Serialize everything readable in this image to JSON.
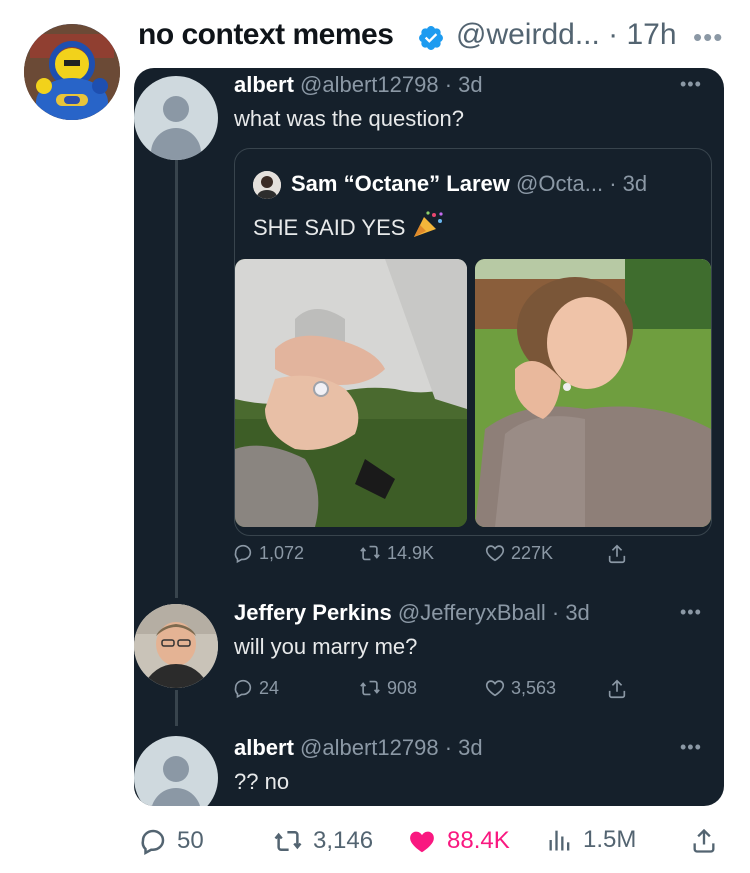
{
  "header": {
    "display_name": "no context memes",
    "handle_time": "@weirdd... · 17h",
    "more_icon": "more-horizontal-icon"
  },
  "embedded_thread": {
    "tweet1": {
      "name": "albert",
      "handle_time": "@albert12798 · 3d",
      "text": "what was the question?"
    },
    "quote": {
      "name": "Sam “Octane” Larew",
      "handle_time": "@Octa... · 3d",
      "text": "SHE SAID YES",
      "emoji_icon": "party-popper-icon",
      "stats": {
        "replies": "1,072",
        "retweets": "14.9K",
        "likes": "227K"
      }
    },
    "tweet2": {
      "name": "Jeffery Perkins",
      "handle_time": "@JefferyxBball · 3d",
      "text": "will you marry me?",
      "stats": {
        "replies": "24",
        "retweets": "908",
        "likes": "3,563"
      }
    },
    "tweet3": {
      "name": "albert",
      "handle_time": "@albert12798 · 3d",
      "text": "?? no"
    }
  },
  "actions": {
    "replies": "50",
    "retweets": "3,146",
    "likes": "88.4K",
    "views": "1.5M",
    "like_color": "#f91880"
  }
}
